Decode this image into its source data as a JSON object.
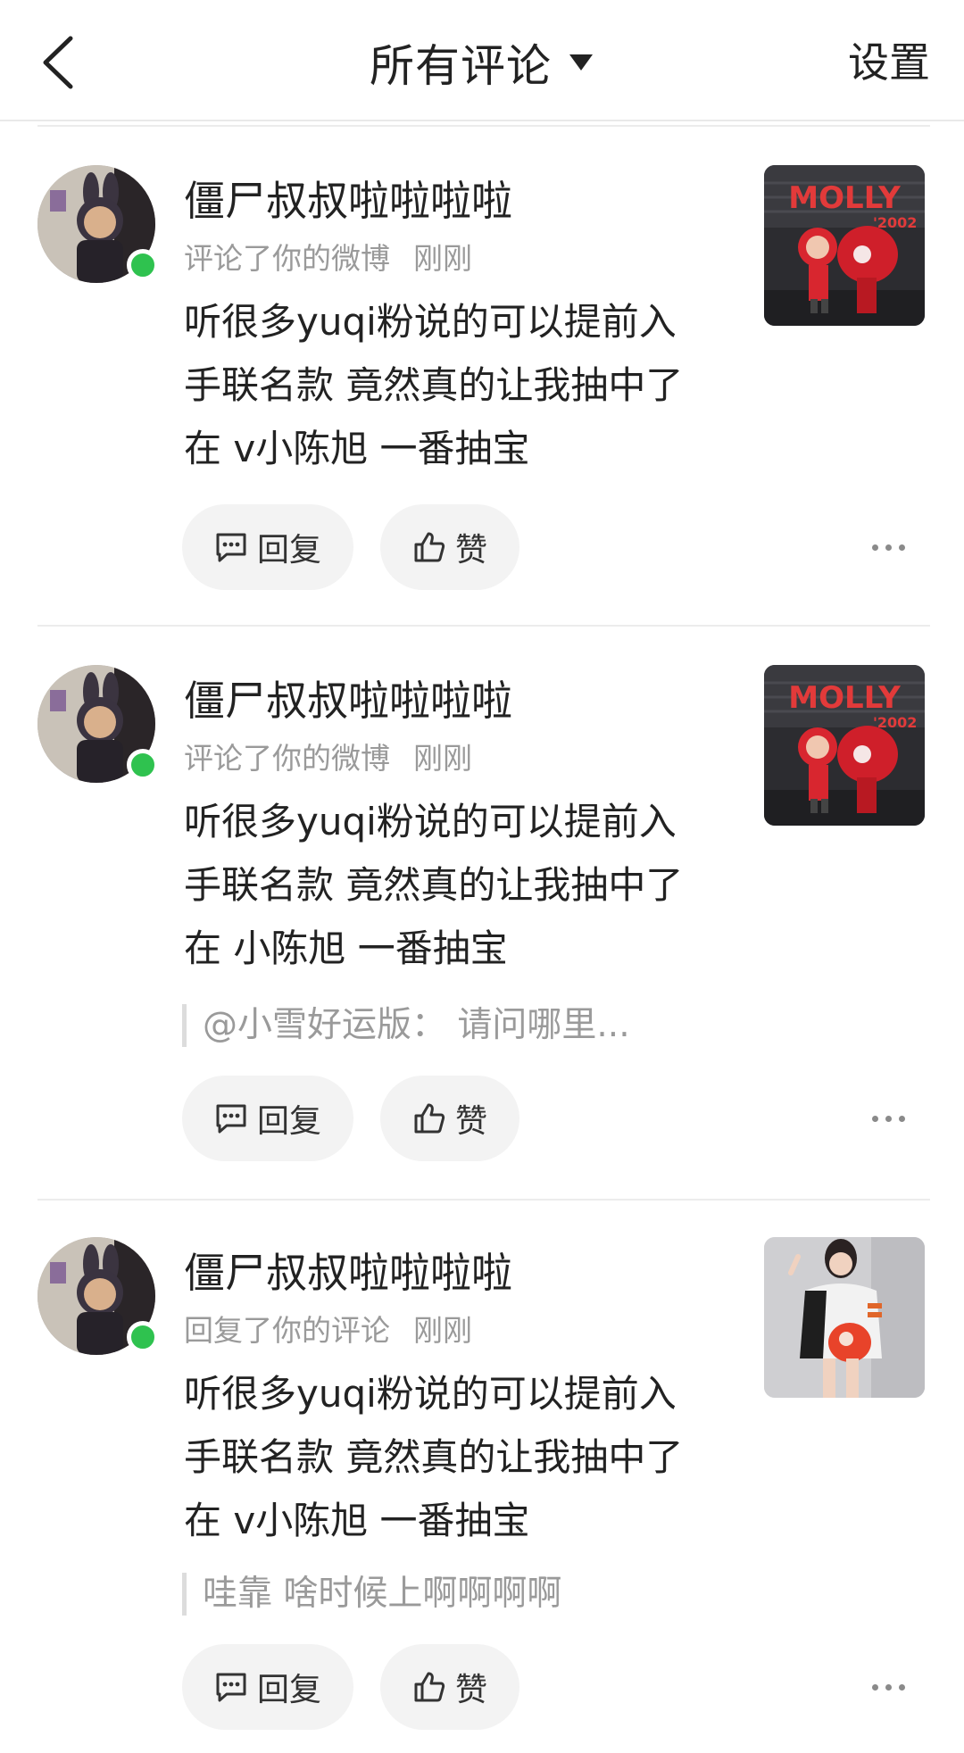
{
  "header": {
    "title": "所有评论",
    "settings_label": "设置"
  },
  "comments": [
    {
      "username": "僵尸叔叔啦啦啦啦",
      "action": "评论了你的微博",
      "time": "刚刚",
      "content_lines": [
        "听很多yuqi粉说的可以提前入",
        "手联名款 竟然真的让我抽中了",
        "在 v小陈旭  一番抽宝"
      ],
      "quote": "",
      "thumb": "molly-poster",
      "reply_label": "回复",
      "like_label": "赞"
    },
    {
      "username": "僵尸叔叔啦啦啦啦",
      "action": "评论了你的微博",
      "time": "刚刚",
      "content_lines": [
        "听很多yuqi粉说的可以提前入",
        "手联名款 竟然真的让我抽中了",
        "在 小陈旭  一番抽宝"
      ],
      "quote": "@小雪好运版：  请问哪里...",
      "thumb": "molly-poster",
      "reply_label": "回复",
      "like_label": "赞"
    },
    {
      "username": "僵尸叔叔啦啦啦啦",
      "action": "回复了你的评论",
      "time": "刚刚",
      "content_lines": [
        "听很多yuqi粉说的可以提前入",
        "手联名款 竟然真的让我抽中了",
        "在 v小陈旭  一番抽宝"
      ],
      "quote": "哇靠 啥时候上啊啊啊啊",
      "thumb": "person-photo",
      "reply_label": "回复",
      "like_label": "赞"
    }
  ],
  "colors": {
    "online": "#2fc24f",
    "molly_red": "#d8262f"
  }
}
